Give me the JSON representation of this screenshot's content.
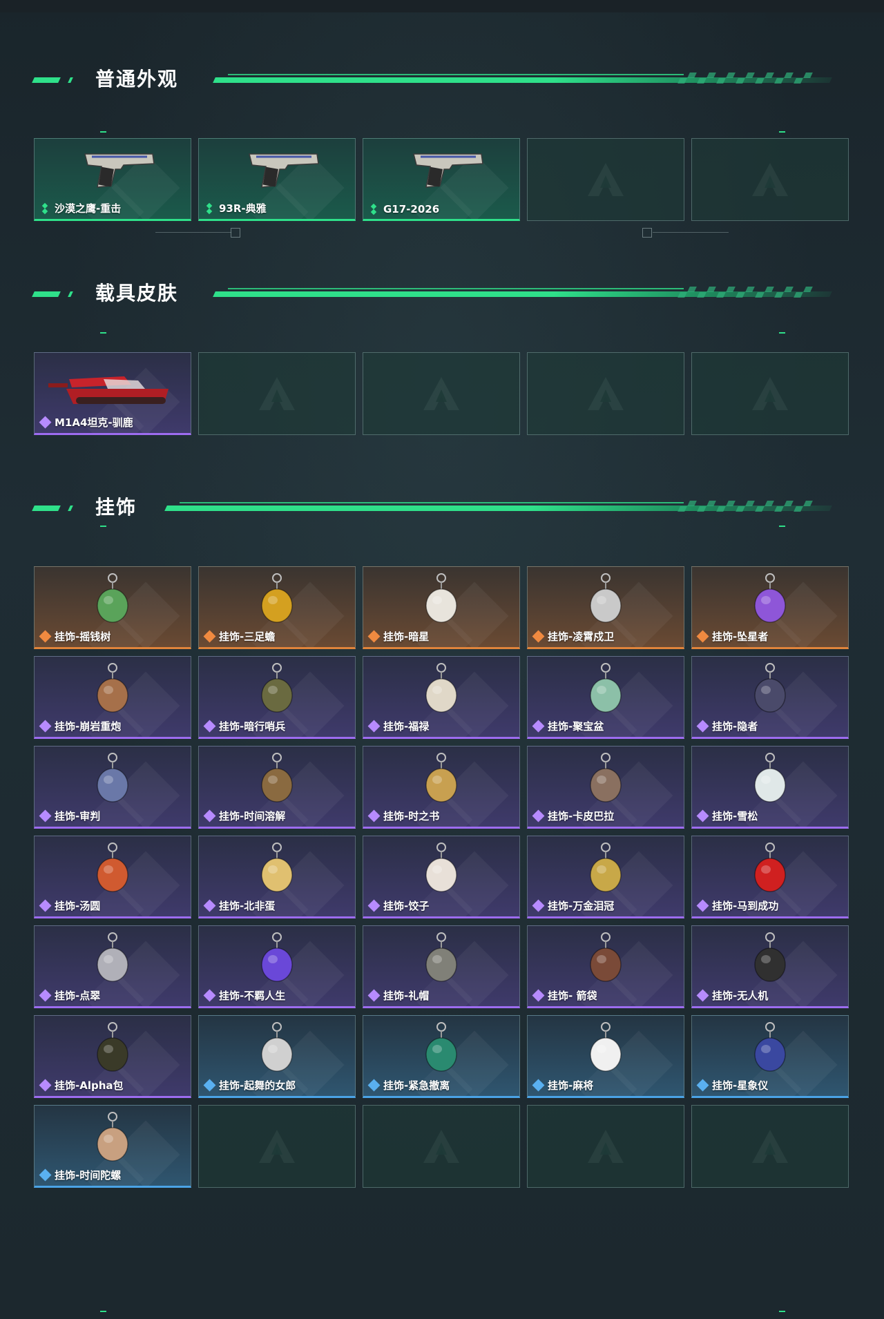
{
  "sections": [
    {
      "title": "普通外观",
      "items": [
        {
          "name": "沙漠之鹰-重击",
          "rarity": "green",
          "icon": "pistol-icon"
        },
        {
          "name": "93R-典雅",
          "rarity": "green",
          "icon": "pistol-icon"
        },
        {
          "name": "G17-2026",
          "rarity": "green",
          "icon": "pistol-icon"
        },
        {
          "name": "",
          "rarity": "empty"
        },
        {
          "name": "",
          "rarity": "empty"
        }
      ]
    },
    {
      "title": "载具皮肤",
      "items": [
        {
          "name": "M1A4坦克-驯鹿",
          "rarity": "purple",
          "icon": "tank-icon"
        },
        {
          "name": "",
          "rarity": "empty"
        },
        {
          "name": "",
          "rarity": "empty"
        },
        {
          "name": "",
          "rarity": "empty"
        },
        {
          "name": "",
          "rarity": "empty"
        }
      ]
    },
    {
      "title": "挂饰",
      "items": [
        {
          "name": "挂饰-摇钱树",
          "rarity": "orange",
          "icon": "charm-icon"
        },
        {
          "name": "挂饰-三足蟾",
          "rarity": "orange",
          "icon": "charm-icon"
        },
        {
          "name": "挂饰-暗星",
          "rarity": "orange",
          "icon": "charm-icon"
        },
        {
          "name": "挂饰-凌霄戍卫",
          "rarity": "orange",
          "icon": "charm-icon"
        },
        {
          "name": "挂饰-坠星者",
          "rarity": "orange",
          "icon": "charm-icon"
        },
        {
          "name": "挂饰-崩岩重炮",
          "rarity": "purple",
          "icon": "charm-icon"
        },
        {
          "name": "挂饰-暗行哨兵",
          "rarity": "purple",
          "icon": "charm-icon"
        },
        {
          "name": "挂饰-福禄",
          "rarity": "purple",
          "icon": "charm-icon"
        },
        {
          "name": "挂饰-聚宝盆",
          "rarity": "purple",
          "icon": "charm-icon"
        },
        {
          "name": "挂饰-隐者",
          "rarity": "purple",
          "icon": "charm-icon"
        },
        {
          "name": "挂饰-审判",
          "rarity": "purple",
          "icon": "charm-icon"
        },
        {
          "name": "挂饰-时间溶解",
          "rarity": "purple",
          "icon": "charm-icon"
        },
        {
          "name": "挂饰-时之书",
          "rarity": "purple",
          "icon": "charm-icon"
        },
        {
          "name": "挂饰-卡皮巴拉",
          "rarity": "purple",
          "icon": "charm-icon"
        },
        {
          "name": "挂饰-雪松",
          "rarity": "purple",
          "icon": "charm-icon"
        },
        {
          "name": "挂饰-汤圆",
          "rarity": "purple",
          "icon": "charm-icon"
        },
        {
          "name": "挂饰-北非蛋",
          "rarity": "purple",
          "icon": "charm-icon"
        },
        {
          "name": "挂饰-饺子",
          "rarity": "purple",
          "icon": "charm-icon"
        },
        {
          "name": "挂饰-万金泪冠",
          "rarity": "purple",
          "icon": "charm-icon"
        },
        {
          "name": "挂饰-马到成功",
          "rarity": "purple",
          "icon": "charm-icon"
        },
        {
          "name": "挂饰-点翠",
          "rarity": "purple",
          "icon": "charm-icon"
        },
        {
          "name": "挂饰-不羁人生",
          "rarity": "purple",
          "icon": "charm-icon"
        },
        {
          "name": "挂饰-礼帽",
          "rarity": "purple",
          "icon": "charm-icon"
        },
        {
          "name": "挂饰- 箭袋",
          "rarity": "purple",
          "icon": "charm-icon"
        },
        {
          "name": "挂饰-无人机",
          "rarity": "purple",
          "icon": "charm-icon"
        },
        {
          "name": "挂饰-Alpha包",
          "rarity": "purple",
          "icon": "charm-icon"
        },
        {
          "name": "挂饰-起舞的女郎",
          "rarity": "blue",
          "icon": "charm-icon"
        },
        {
          "name": "挂饰-紧急撤离",
          "rarity": "blue",
          "icon": "charm-icon"
        },
        {
          "name": "挂饰-麻将",
          "rarity": "blue",
          "icon": "charm-icon"
        },
        {
          "name": "挂饰-星象仪",
          "rarity": "blue",
          "icon": "charm-icon"
        },
        {
          "name": "挂饰-时间陀螺",
          "rarity": "blue",
          "icon": "charm-icon"
        },
        {
          "name": "",
          "rarity": "empty"
        },
        {
          "name": "",
          "rarity": "empty"
        },
        {
          "name": "",
          "rarity": "empty"
        },
        {
          "name": "",
          "rarity": "empty"
        }
      ]
    }
  ],
  "colors": {
    "accent": "#2fe08a",
    "green": "#2fe08a",
    "purple": "#9d6cf0",
    "orange": "#e0843b",
    "blue": "#4aa3e6"
  }
}
